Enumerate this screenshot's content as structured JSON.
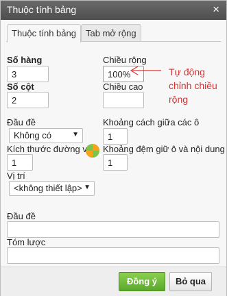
{
  "dialog": {
    "title": "Thuộc tính bảng",
    "close_symbol": "×"
  },
  "tabs": [
    {
      "label": "Thuộc tính bảng"
    },
    {
      "label": "Tab mở rộng"
    }
  ],
  "form": {
    "rows_label": "Số hàng",
    "rows_value": "3",
    "cols_label": "Số cột",
    "cols_value": "2",
    "width_label": "Chiều rộng",
    "width_value": "100%",
    "height_label": "Chiều cao",
    "height_value": "",
    "header_label": "Đầu đề",
    "header_value": "Không có",
    "cell_spacing_label": "Khoảng cách giữa các ô",
    "cell_spacing_value": "1",
    "border_label": "Kích thước đường vi",
    "border_value": "1",
    "cell_padding_label": "Khoảng đệm giữ ô và nội dung",
    "cell_padding_value": "1",
    "align_label": "Vị trí",
    "align_value": "<không thiết lập>",
    "caption_label": "Đầu đề",
    "caption_value": "",
    "summary_label": "Tóm lược",
    "summary_value": ""
  },
  "annotation": {
    "line1": "Tự động",
    "line2": "chỉnh chiều",
    "line3": "rộng",
    "color": "#e03030"
  },
  "footer": {
    "ok_label": "Đồng ý",
    "cancel_label": "Bỏ qua"
  }
}
